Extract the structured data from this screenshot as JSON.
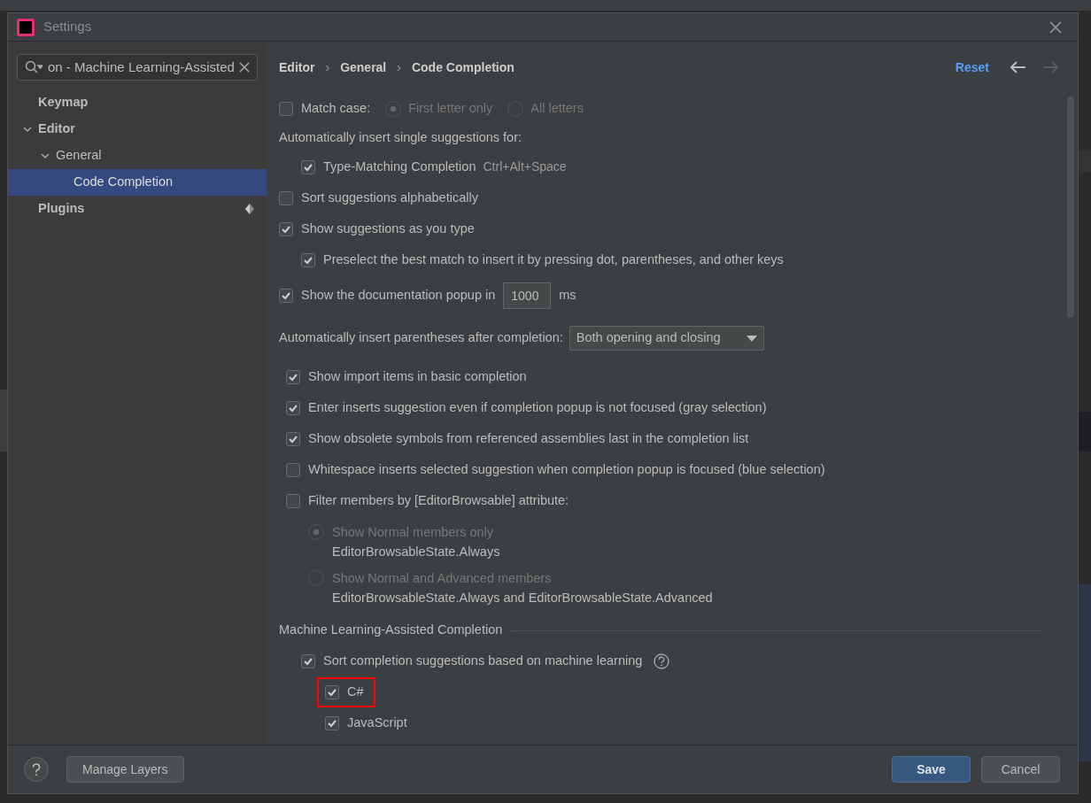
{
  "window": {
    "title": "Settings"
  },
  "search": {
    "value": "on - Machine Learning-Assisted"
  },
  "sidebar": {
    "items": [
      {
        "label": "Keymap",
        "bold": true,
        "selected": false,
        "expandable": false
      },
      {
        "label": "Editor",
        "bold": true,
        "selected": false,
        "expandable": true,
        "expanded": true,
        "children": [
          {
            "label": "General",
            "bold": false,
            "selected": false,
            "expandable": true,
            "expanded": true,
            "children": [
              {
                "label": "Code Completion",
                "bold": false,
                "selected": true,
                "expandable": false
              }
            ]
          }
        ]
      },
      {
        "label": "Plugins",
        "bold": true,
        "selected": false,
        "expandable": false,
        "badge": true
      }
    ]
  },
  "breadcrumb": {
    "separator": "›",
    "items": [
      "Editor",
      "General",
      "Code Completion"
    ]
  },
  "header": {
    "reset": "Reset",
    "back_disabled": false,
    "forward_disabled": true
  },
  "options": [
    {
      "kind": "radio_choice",
      "label": "Match case:",
      "checked": false,
      "radios": [
        {
          "label": "First letter only",
          "selected": true,
          "disabled": true
        },
        {
          "label": "All letters",
          "selected": false,
          "disabled": true
        }
      ]
    },
    {
      "kind": "label",
      "label": "Automatically insert single suggestions for:",
      "children": [
        {
          "kind": "checkbox",
          "label": "Type-Matching Completion",
          "checked": true,
          "shortcut": "Ctrl+Alt+Space"
        }
      ]
    },
    {
      "kind": "checkbox",
      "label": "Sort suggestions alphabetically",
      "checked": false
    },
    {
      "kind": "checkbox",
      "label": "Show suggestions as you type",
      "checked": true,
      "children": [
        {
          "kind": "checkbox",
          "label": "Preselect the best match to insert it by pressing dot, parentheses, and other keys",
          "checked": true
        }
      ]
    },
    {
      "kind": "number",
      "label": "Show the documentation popup in",
      "checked": true,
      "value": "1000",
      "unit": "ms"
    },
    {
      "kind": "dropdown",
      "label": "Automatically insert parentheses after completion:",
      "value": "Both opening and closing"
    }
  ],
  "rider_options": [
    {
      "kind": "checkbox",
      "label": "Show import items in basic completion",
      "checked": true
    },
    {
      "kind": "checkbox",
      "label": "Enter inserts suggestion even if completion popup is not focused (gray selection)",
      "checked": true
    },
    {
      "kind": "checkbox",
      "label": "Show obsolete symbols from referenced assemblies last in the completion list",
      "checked": true
    },
    {
      "kind": "checkbox",
      "label": "Whitespace inserts selected suggestion when completion popup is focused (blue selection)",
      "checked": false
    },
    {
      "kind": "checkbox",
      "label": "Filter members by [EditorBrowsable] attribute:",
      "checked": false,
      "children": [
        {
          "kind": "radio",
          "label": "Show Normal members only",
          "detail": "EditorBrowsableState.Always",
          "selected": true,
          "disabled": true
        },
        {
          "kind": "radio",
          "label": "Show Normal and Advanced members",
          "detail": "EditorBrowsableState.Always and EditorBrowsableState.Advanced",
          "selected": false,
          "disabled": true
        }
      ]
    }
  ],
  "ml_section": {
    "title": "Machine Learning-Assisted Completion",
    "option": {
      "label": "Sort completion suggestions based on machine learning",
      "checked": true,
      "help": true
    },
    "languages": [
      {
        "label": "C#",
        "checked": true,
        "highlighted": true
      },
      {
        "label": "JavaScript",
        "checked": true,
        "highlighted": false
      }
    ]
  },
  "footer": {
    "manage_layers": "Manage Layers",
    "save": "Save",
    "cancel": "Cancel"
  }
}
